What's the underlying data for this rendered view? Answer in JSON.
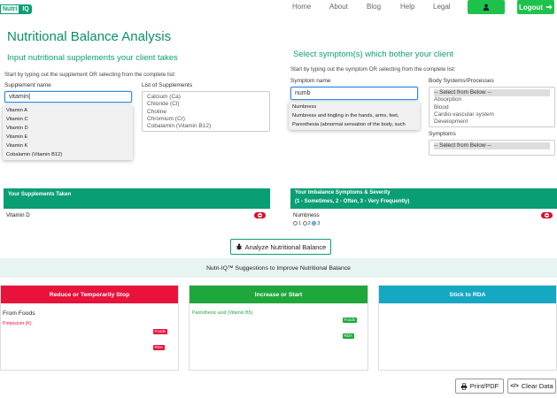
{
  "app": {
    "logo_left": "Nutri",
    "logo_right": "IQ"
  },
  "nav": {
    "home": "Home",
    "about": "About",
    "blog": "Blog",
    "help": "Help",
    "legal": "Legal",
    "user_icon": "user-icon",
    "logout": "Logout"
  },
  "page": {
    "title": "Nutritional Balance Analysis"
  },
  "supplements": {
    "heading": "Input nutritional supplements your client takes",
    "hint": "Start by typing out the supplement OR selecting from the complete list:",
    "name_label": "Supplement name",
    "input_value": "vitamin",
    "autocomplete": [
      "Vitamin A",
      "Vitamin C",
      "Vitamin D",
      "Vitamin E",
      "Vitamin K",
      "Cobalamin (Vitamin B12)"
    ],
    "list_label": "List of Supplements",
    "list": [
      "Calcium (Ca)",
      "Chloride (Cl)",
      "Choline",
      "Chromium (Cr)",
      "Cobalamin (Vitamin B12)"
    ]
  },
  "symptoms": {
    "heading": "Select symptom(s) which bother your client",
    "hint": "Start by typing out the symptom OR selecting from the complete list:",
    "name_label": "Symptom name",
    "input_value": "numb",
    "autocomplete": [
      "Numbness",
      "Numbness and tingling in the hands, arms, feet,",
      "Paresthesia (abnormal sensation of the body, such"
    ],
    "body_label": "Body Systems/Processes",
    "body_list": [
      "-- Select from Below --",
      "Absorption",
      "Blood",
      "Cardio-vascular system",
      "Development"
    ],
    "symptoms_label": "Symptoms",
    "symptoms_list": [
      "-- Select from Below --"
    ]
  },
  "taken": {
    "header": "Your Supplements Taken",
    "items": [
      "Vitamin D"
    ]
  },
  "imbalance": {
    "header_line1": "Your Imbalance Symptoms & Severity",
    "header_line2": "(1 - Sometimes, 2 - Often, 3 - Very Frequently)",
    "items": [
      {
        "name": "Numbness",
        "severity": 3,
        "r1": "1",
        "r2": "2",
        "r3": "3"
      }
    ]
  },
  "analyze_button": "Analyze Nutritional Balance",
  "suggestions_band": "Nutri-IQ™ Suggestions to Improve Nutritional Balance",
  "cards": {
    "reduce": {
      "header": "Reduce or Temporarily Stop",
      "sub": "From Foods",
      "items": [
        {
          "name": "Potassium (K)",
          "tag1": "Foods",
          "tag2": "RDA"
        }
      ],
      "color": "#e8123a"
    },
    "increase": {
      "header": "Increase or Start",
      "items": [
        {
          "name": "Pantothenic acid (Vitamin B5)",
          "tag1": "Foods",
          "tag2": "RDA"
        }
      ],
      "color": "#1ea83c"
    },
    "rda": {
      "header": "Stick to RDA",
      "color": "#15a8c2"
    }
  },
  "footer": {
    "print": "Print/PDF",
    "clear": "Clear Data"
  }
}
